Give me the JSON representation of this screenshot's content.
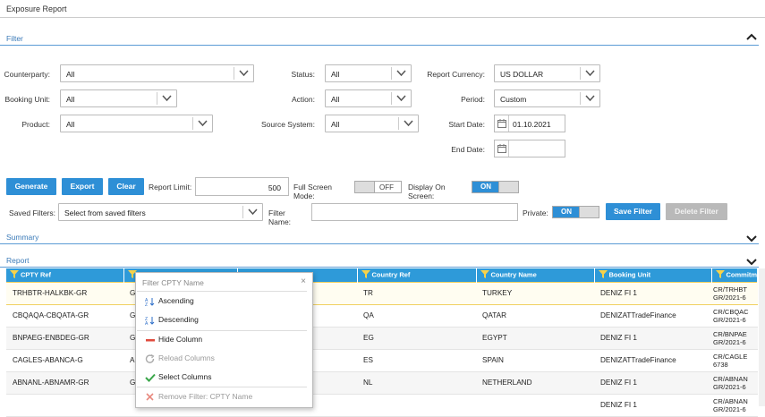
{
  "window": {
    "title": "Exposure Report"
  },
  "filter_section": {
    "title": "Filter"
  },
  "filters": {
    "counterparty": {
      "label": "Counterparty:",
      "value": "All"
    },
    "booking_unit": {
      "label": "Booking Unit:",
      "value": "All"
    },
    "product": {
      "label": "Product:",
      "value": "All"
    },
    "status": {
      "label": "Status:",
      "value": "All"
    },
    "action": {
      "label": "Action:",
      "value": "All"
    },
    "source_system": {
      "label": "Source System:",
      "value": "All"
    },
    "report_currency": {
      "label": "Report Currency:",
      "value": "US DOLLAR"
    },
    "period": {
      "label": "Period:",
      "value": "Custom"
    },
    "start_date": {
      "label": "Start Date:",
      "value": "01.10.2021"
    },
    "end_date": {
      "label": "End Date:",
      "value": ""
    }
  },
  "actions": {
    "generate": "Generate",
    "export": "Export",
    "clear": "Clear",
    "report_limit_label": "Report Limit:",
    "report_limit_value": "500",
    "full_screen_label": "Full Screen Mode:",
    "full_screen_state": "OFF",
    "display_on_screen_label": "Display On Screen:",
    "display_on_screen_state": "ON"
  },
  "saved_filters": {
    "label": "Saved Filters:",
    "placeholder": "Select from saved filters",
    "filter_name_label": "Filter Name:",
    "filter_name_value": "",
    "private_label": "Private:",
    "private_state": "ON",
    "save_button": "Save Filter",
    "delete_button": "Delete Filter"
  },
  "summary_section": {
    "title": "Summary"
  },
  "report_section": {
    "title": "Report"
  },
  "table": {
    "headers": [
      "CPTY Ref",
      "",
      "",
      "Country Ref",
      "Country Name",
      "Booking Unit",
      "Commitm"
    ],
    "rows": [
      {
        "cpty_ref": "TRHBTR-HALKBK-GR",
        "cpty_name": "G B",
        "country_ref": "TR",
        "country_name": "TURKEY",
        "booking_unit": "DENIZ FI 1",
        "commitment": "CR/TRHBT GR/2021-6"
      },
      {
        "cpty_ref": "CBQAQA-CBQATA-GR",
        "cpty_name": "G B",
        "country_ref": "QA",
        "country_name": "QATAR",
        "booking_unit": "DENIZATTradeFinance",
        "commitment": "CR/CBQAC GR/2021-6"
      },
      {
        "cpty_ref": "BNPAEG-ENBDEG-GR",
        "cpty_name": "G B",
        "country_ref": "EG",
        "country_name": "EGYPT",
        "booking_unit": "DENIZ FI 1",
        "commitment": "CR/BNPAE GR/2021-6"
      },
      {
        "cpty_ref": "CAGLES-ABANCA-G",
        "cpty_name": "A B",
        "country_ref": "ES",
        "country_name": "SPAIN",
        "booking_unit": "DENIZATTradeFinance",
        "commitment": "CR/CAGLE 6738"
      },
      {
        "cpty_ref": "ABNANL-ABNAMR-GR",
        "cpty_name": "G",
        "country_ref": "NL",
        "country_name": "NETHERLAND",
        "booking_unit": "DENIZ FI 1",
        "commitment": "CR/ABNAN GR/2021-6"
      },
      {
        "cpty_ref": "",
        "cpty_name": "",
        "country_ref": "",
        "country_name": "",
        "booking_unit": "DENIZ FI 1",
        "commitment": "CR/ABNAN GR/2021-6"
      }
    ]
  },
  "column_popup": {
    "title": "Filter CPTY Name",
    "close": "×",
    "items": [
      "Ascending",
      "Descending",
      "Hide Column",
      "Reload Columns",
      "Select Columns",
      "Remove Filter: CPTY Name"
    ]
  },
  "colors": {
    "accent": "#2e8fd6",
    "header_blue": "#2e9ad9",
    "disabled": "#b9b9b9",
    "remove_red": "#e04b3c",
    "select_green": "#3aa64a"
  }
}
